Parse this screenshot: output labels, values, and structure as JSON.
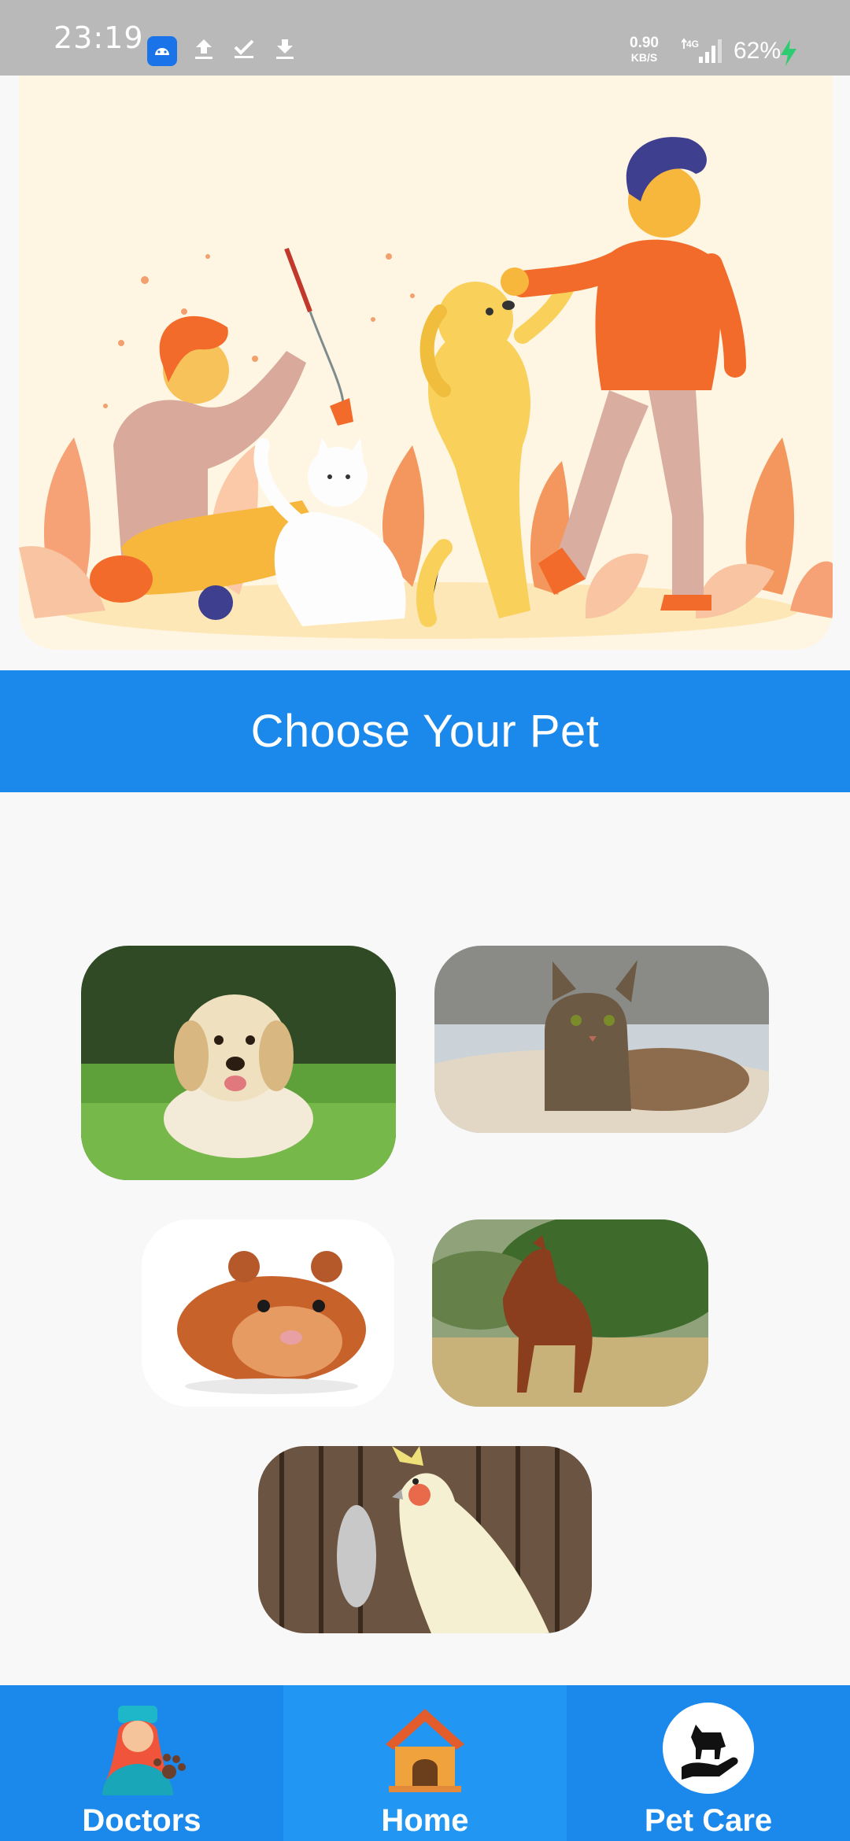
{
  "status_bar": {
    "time": "23:19",
    "net_speed_value": "0.90",
    "net_speed_unit": "KB/S",
    "network": "4G",
    "battery": "62%"
  },
  "main": {
    "title": "Choose Your Pet",
    "pets": [
      {
        "name": "dog"
      },
      {
        "name": "cat"
      },
      {
        "name": "hamster"
      },
      {
        "name": "horse"
      },
      {
        "name": "bird"
      }
    ]
  },
  "bottom_nav": {
    "items": [
      {
        "label": "Doctors",
        "icon": "doctor-icon"
      },
      {
        "label": "Home",
        "icon": "home-icon"
      },
      {
        "label": "Pet Care",
        "icon": "pet-care-icon"
      }
    ],
    "active_index": 1
  },
  "colors": {
    "primary": "#1b88ec",
    "active_tab": "#2196f3",
    "hero_bg": "#fef6e3",
    "status_bar": "#b9b9b9"
  }
}
